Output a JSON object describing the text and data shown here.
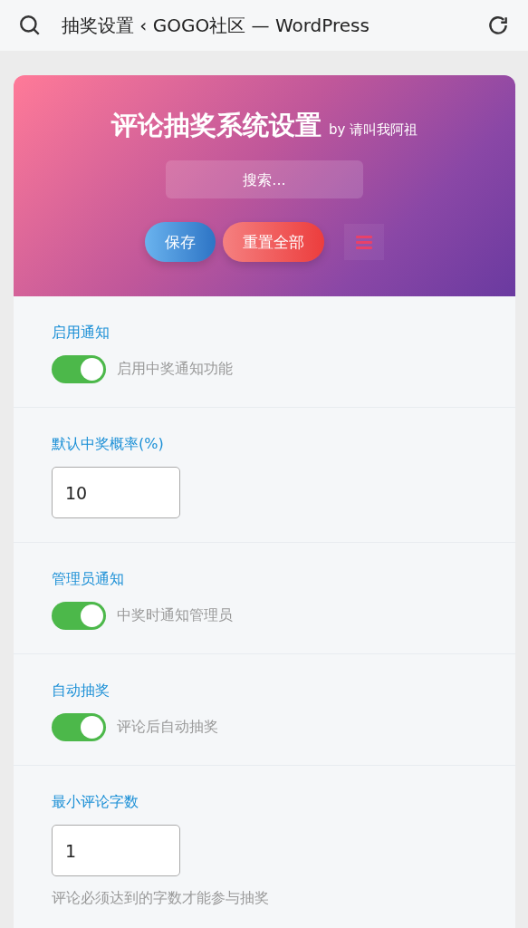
{
  "browser_bar": {
    "title": "抽奖设置 ‹ GOGO社区 — WordPress"
  },
  "header": {
    "title": "评论抽奖系统设置",
    "byline": "by 请叫我阿祖",
    "search": {
      "placeholder": "搜索..."
    },
    "buttons": [
      {
        "kind": "save",
        "label": "保存"
      },
      {
        "kind": "reset",
        "label": "重置全部"
      },
      {
        "kind": "menu"
      }
    ]
  },
  "settings": [
    {
      "kind": "toggle",
      "label": "启用通知",
      "on": true,
      "description": "启用中奖通知功能"
    },
    {
      "kind": "number",
      "label": "默认中奖概率(%)",
      "value": "10"
    },
    {
      "kind": "toggle",
      "label": "管理员通知",
      "on": true,
      "description": "中奖时通知管理员"
    },
    {
      "kind": "toggle",
      "label": "自动抽奖",
      "on": true,
      "description": "评论后自动抽奖"
    },
    {
      "kind": "number",
      "label": "最小评论字数",
      "value": "1",
      "help": "评论必须达到的字数才能参与抽奖"
    }
  ]
}
